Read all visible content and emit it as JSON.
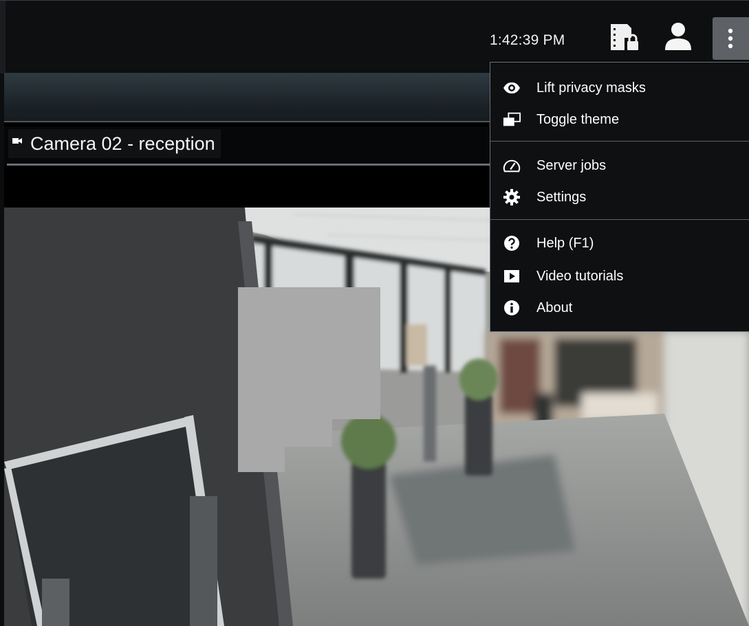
{
  "topbar": {
    "clock": "1:42:39 PM",
    "icons": [
      "license-lock-icon",
      "user-icon",
      "more-vertical-icon"
    ]
  },
  "camera": {
    "title": "Camera 02 - reception",
    "icon": "video-camera-icon"
  },
  "menu": {
    "groups": [
      [
        {
          "label": "Lift privacy masks",
          "icon": "eye-icon"
        },
        {
          "label": "Toggle theme",
          "icon": "toggle-theme-icon"
        }
      ],
      [
        {
          "label": "Server jobs",
          "icon": "gauge-icon"
        },
        {
          "label": "Settings",
          "icon": "gear-icon"
        }
      ],
      [
        {
          "label": "Help (F1)",
          "icon": "help-circle-icon"
        },
        {
          "label": "Video tutorials",
          "icon": "play-icon"
        },
        {
          "label": "About",
          "icon": "info-circle-icon"
        }
      ]
    ]
  },
  "colors": {
    "topbar_bg": "#0e0f11",
    "menu_bg": "#0f1012",
    "menu_border": "#6b7075",
    "privacy_mask": "#a9a9a9",
    "more_button_bg": "#5e6165"
  }
}
